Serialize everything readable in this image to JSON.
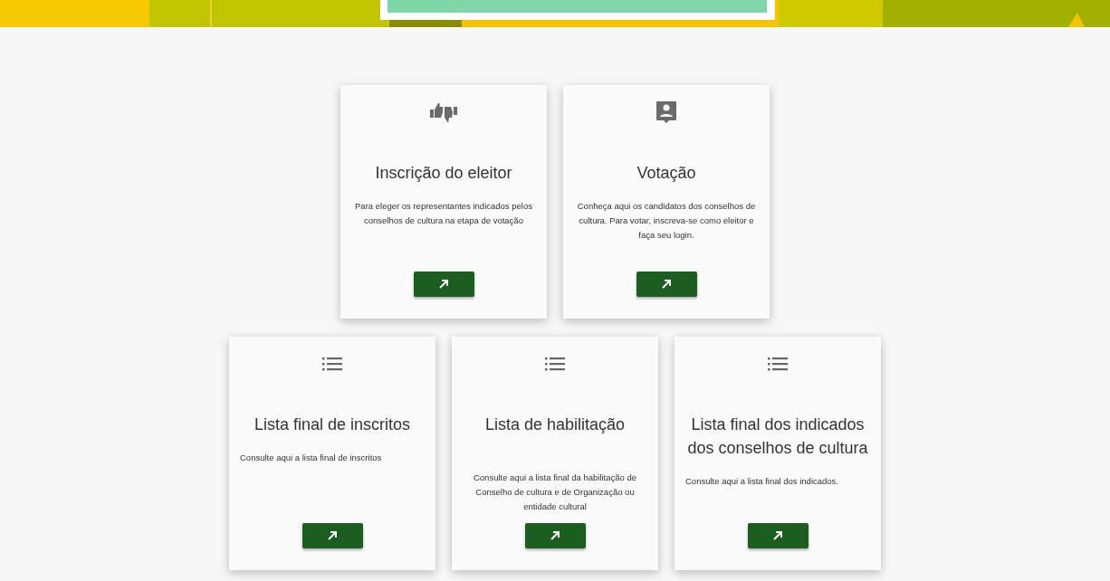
{
  "cards": [
    {
      "kind": "thumbs",
      "title": "Inscrição do eleitor",
      "description": "Para eleger os representantes indicados pelos conselhos de cultura na etapa de votação"
    },
    {
      "kind": "contact",
      "title": "Votação",
      "description": "Conheça aqui os candidatos dos conselhos de cultura. Para votar, inscreva-se como eleitor e faça seu login."
    },
    {
      "kind": "list",
      "title": "Lista final de inscritos",
      "description": "Consulte aqui a lista final de inscritos"
    },
    {
      "kind": "list",
      "title": "Lista de habilitação",
      "description": "Consulte aqui a lista final da habilitação de Conselho de cultura e de Organização ou entidade cultural"
    },
    {
      "kind": "list",
      "title": "Lista final dos indicados dos conselhos de cultura",
      "description": "Consulte aqui a lista final dos indicados."
    }
  ]
}
